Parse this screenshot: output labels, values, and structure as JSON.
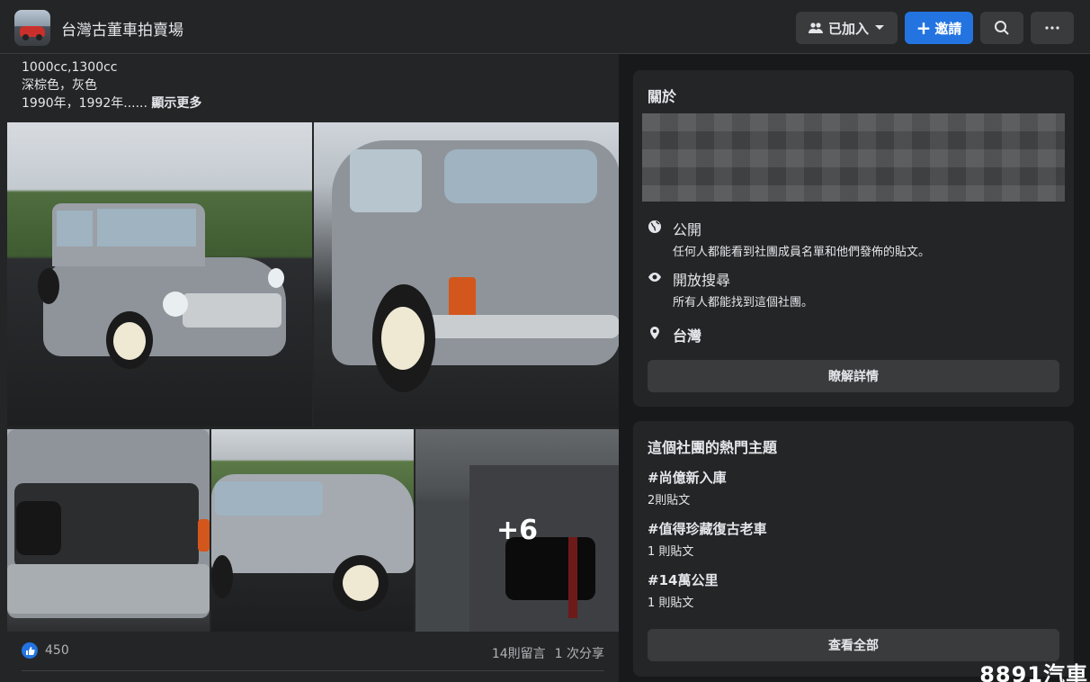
{
  "header": {
    "group_name": "台灣古董車拍賣場",
    "joined_label": "已加入",
    "invite_label": "邀請"
  },
  "post": {
    "lines": [
      "1000cc,1300cc",
      "深棕色，灰色",
      "1990年，1992年......"
    ],
    "see_more": "顯示更多",
    "more_photos": "+6",
    "like_count": "450",
    "comments": "14則留言",
    "shares": "1 次分享"
  },
  "about": {
    "title": "關於",
    "privacy_title": "公開",
    "privacy_desc": "任何人都能看到社團成員名單和他們發佈的貼文。",
    "visibility_title": "開放搜尋",
    "visibility_desc": "所有人都能找到這個社團。",
    "location": "台灣",
    "details_button": "瞭解詳情"
  },
  "topics": {
    "title": "這個社團的熱門主題",
    "items": [
      {
        "tag": "#尚億新入庫",
        "count": "2則貼文"
      },
      {
        "tag": "#值得珍藏復古老車",
        "count": "1 則貼文"
      },
      {
        "tag": "#14萬公里",
        "count": "1 則貼文"
      }
    ],
    "see_all": "查看全部"
  },
  "watermark": "8891汽車",
  "colors": {
    "accent": "#2374e1",
    "background": "#18191a",
    "card": "#242526"
  }
}
